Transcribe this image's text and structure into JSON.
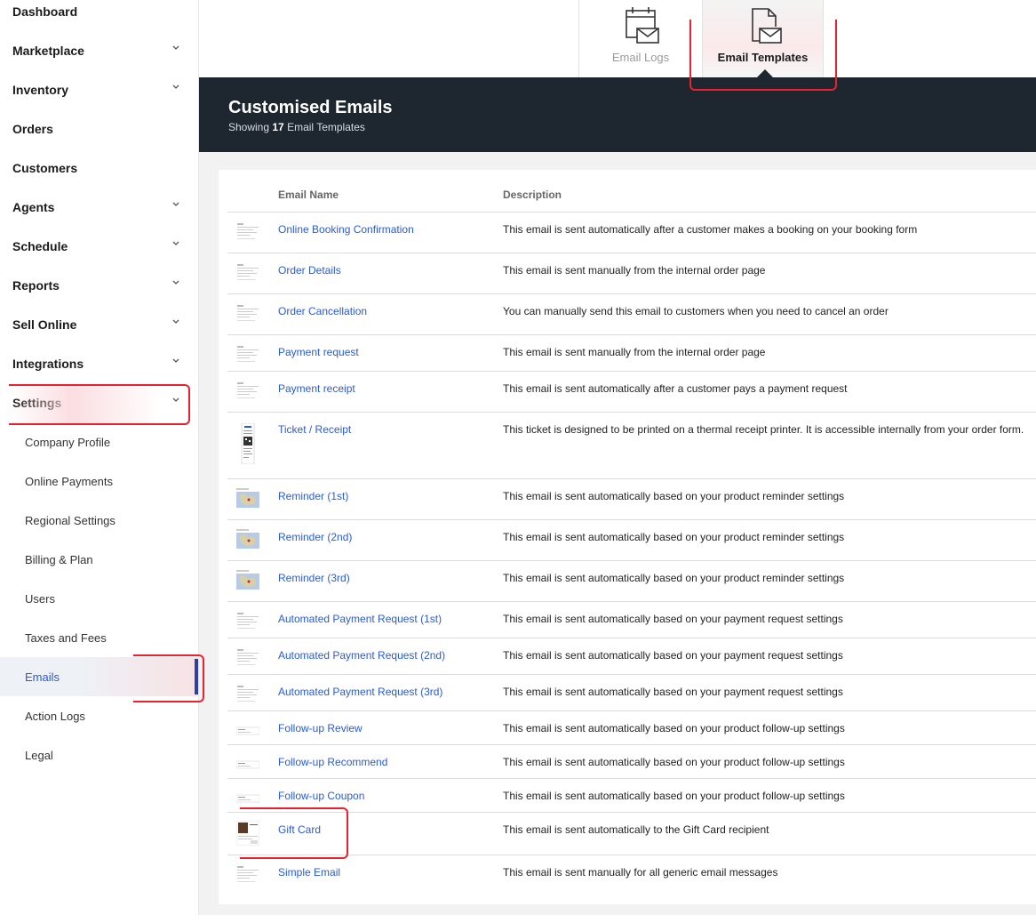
{
  "sidebar": {
    "items": [
      {
        "label": "Dashboard",
        "expandable": false
      },
      {
        "label": "Marketplace",
        "expandable": true
      },
      {
        "label": "Inventory",
        "expandable": true
      },
      {
        "label": "Orders",
        "expandable": false
      },
      {
        "label": "Customers",
        "expandable": false
      },
      {
        "label": "Agents",
        "expandable": true
      },
      {
        "label": "Schedule",
        "expandable": true
      },
      {
        "label": "Reports",
        "expandable": true
      },
      {
        "label": "Sell Online",
        "expandable": true
      },
      {
        "label": "Integrations",
        "expandable": true
      },
      {
        "label": "Settings",
        "expandable": true
      }
    ],
    "settings_subitems": [
      {
        "label": "Company Profile"
      },
      {
        "label": "Online Payments"
      },
      {
        "label": "Regional Settings"
      },
      {
        "label": "Billing & Plan"
      },
      {
        "label": "Users"
      },
      {
        "label": "Taxes and Fees"
      },
      {
        "label": "Emails",
        "active": true
      },
      {
        "label": "Action Logs"
      },
      {
        "label": "Legal"
      }
    ]
  },
  "tabs": [
    {
      "label": "Email Logs",
      "icon": "calendar-mail-icon"
    },
    {
      "label": "Email Templates",
      "icon": "document-mail-icon",
      "active": true
    }
  ],
  "header": {
    "title": "Customised Emails",
    "subtitle_prefix": "Showing",
    "count": "17",
    "subtitle_suffix": "Email Templates"
  },
  "table": {
    "columns": [
      "Email Name",
      "Description"
    ],
    "rows": [
      {
        "name": "Online Booking Confirmation",
        "description": "This email is sent automatically after a customer makes a booking on your booking form",
        "thumb": "doc"
      },
      {
        "name": "Order Details",
        "description": "This email is sent manually from the internal order page",
        "thumb": "doc"
      },
      {
        "name": "Order Cancellation",
        "description": "You can manually send this email to customers when you need to cancel an order",
        "thumb": "doc"
      },
      {
        "name": "Payment request",
        "description": "This email is sent manually from the internal order page",
        "thumb": "doc"
      },
      {
        "name": "Payment receipt",
        "description": "This email is sent automatically after a customer pays a payment request",
        "thumb": "doc"
      },
      {
        "name": "Ticket / Receipt",
        "description": "This ticket is designed to be printed on a thermal receipt printer. It is accessible internally from your order form.",
        "thumb": "ticket"
      },
      {
        "name": "Reminder (1st)",
        "description": "This email is sent automatically based on your product reminder settings",
        "thumb": "map"
      },
      {
        "name": "Reminder (2nd)",
        "description": "This email is sent automatically based on your product reminder settings",
        "thumb": "map"
      },
      {
        "name": "Reminder (3rd)",
        "description": "This email is sent automatically based on your product reminder settings",
        "thumb": "map"
      },
      {
        "name": "Automated Payment Request (1st)",
        "description": "This email is sent automatically based on your payment request settings",
        "thumb": "doc"
      },
      {
        "name": "Automated Payment Request (2nd)",
        "description": "This email is sent automatically based on your payment request settings",
        "thumb": "doc"
      },
      {
        "name": "Automated Payment Request (3rd)",
        "description": "This email is sent automatically based on your payment request settings",
        "thumb": "doc"
      },
      {
        "name": "Follow-up Review",
        "description": "This email is sent automatically based on your product follow-up settings",
        "thumb": "slim"
      },
      {
        "name": "Follow-up Recommend",
        "description": "This email is sent automatically based on your product follow-up settings",
        "thumb": "slim"
      },
      {
        "name": "Follow-up Coupon",
        "description": "This email is sent automatically based on your product follow-up settings",
        "thumb": "slim"
      },
      {
        "name": "Gift Card",
        "description": "This email is sent automatically to the Gift Card recipient",
        "thumb": "gift"
      },
      {
        "name": "Simple Email",
        "description": "This email is sent manually for all generic email messages",
        "thumb": "doc"
      }
    ]
  },
  "colors": {
    "accent": "#e8232f",
    "link": "#2a5bd7",
    "header_bg": "#1e2630",
    "active_bar": "#2b3fa6"
  }
}
